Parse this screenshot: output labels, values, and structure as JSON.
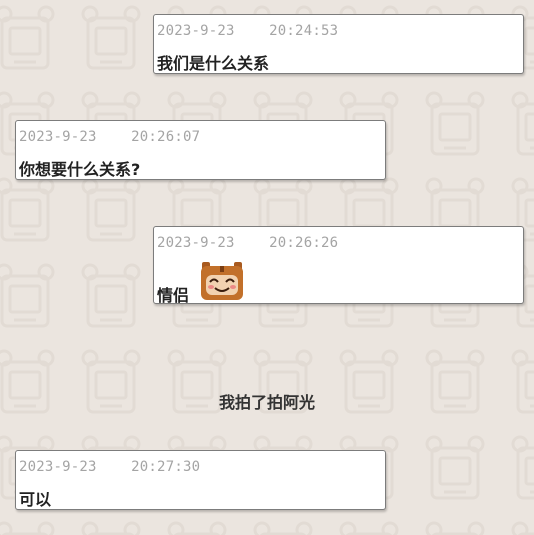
{
  "messages": [
    {
      "timestamp": "2023-9-23    20:24:53",
      "text": "我们是什么关系"
    },
    {
      "timestamp": "2023-9-23    20:26:07",
      "text": "你想要什么关系?"
    },
    {
      "timestamp": "2023-9-23    20:26:26",
      "text": "情侣",
      "emoji": "smiling-tiger-face-icon"
    },
    {
      "timestamp": "2023-9-23    20:27:30",
      "text": "可以"
    }
  ],
  "system_notice": "我拍了拍阿光",
  "colors": {
    "background": "#ebe5df",
    "bubble": "#ffffff",
    "bubble_border": "#7c7c7c",
    "timestamp": "#a4a4a4",
    "text": "#222222"
  }
}
